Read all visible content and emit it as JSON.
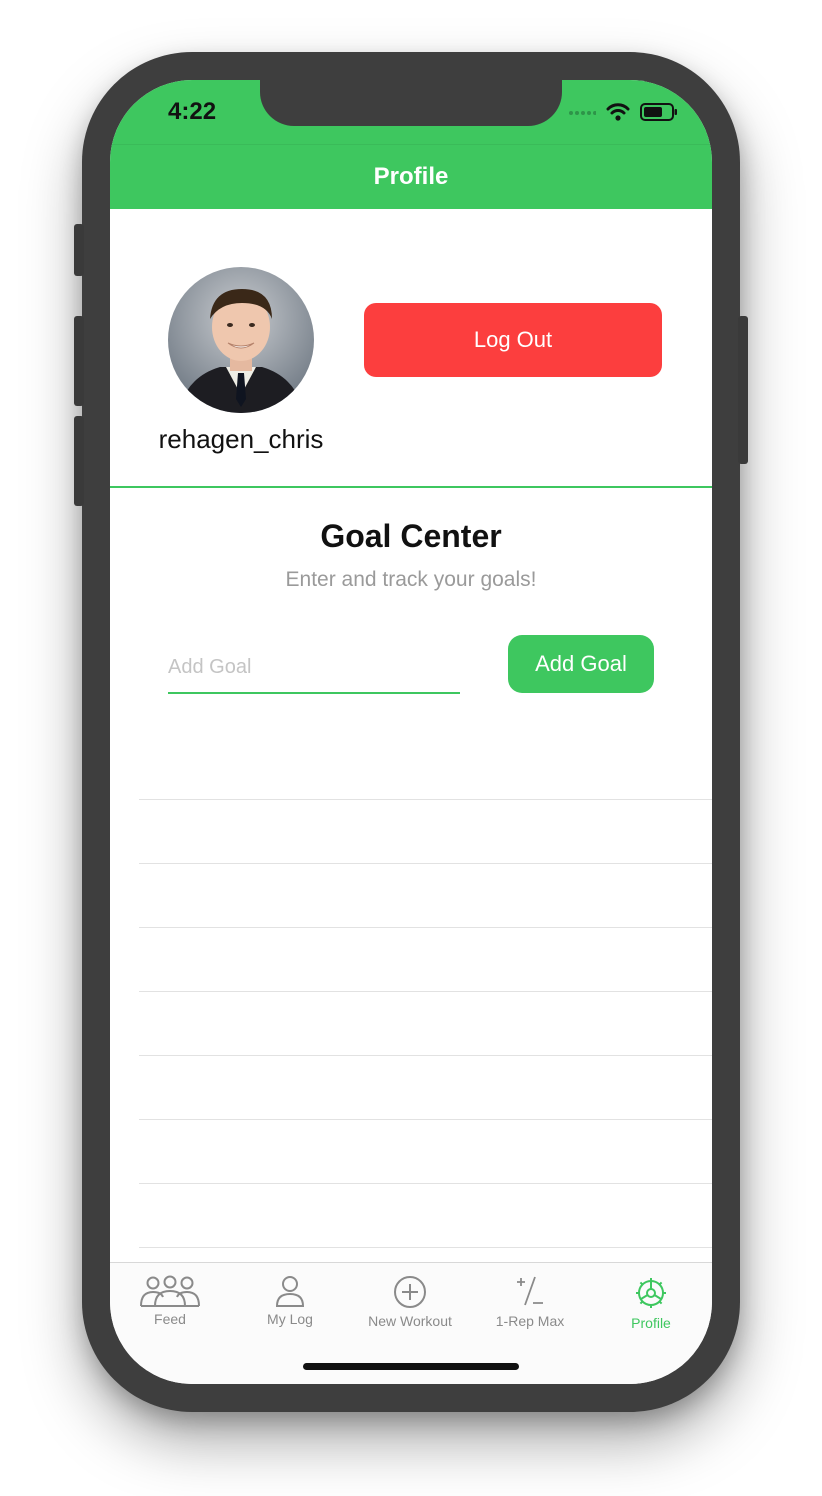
{
  "status_bar": {
    "time": "4:22",
    "icons": [
      "signal-dots-icon",
      "wifi-icon",
      "battery-icon"
    ]
  },
  "nav": {
    "title": "Profile"
  },
  "profile": {
    "username": "rehagen_chris",
    "logout_label": "Log Out"
  },
  "goal_center": {
    "title": "Goal Center",
    "subtitle": "Enter and track your goals!",
    "input_placeholder": "Add Goal",
    "input_value": "",
    "add_label": "Add Goal"
  },
  "tabs": [
    {
      "label": "Feed",
      "icon": "people-group-icon",
      "active": false
    },
    {
      "label": "My Log",
      "icon": "person-icon",
      "active": false
    },
    {
      "label": "New Workout",
      "icon": "plus-circle-icon",
      "active": false
    },
    {
      "label": "1-Rep Max",
      "icon": "plus-minus-icon",
      "active": false
    },
    {
      "label": "Profile",
      "icon": "gear-icon",
      "active": true
    }
  ],
  "colors": {
    "accent": "#3ec75f",
    "danger": "#fc3e3e",
    "muted_text": "#9a9a9a"
  }
}
